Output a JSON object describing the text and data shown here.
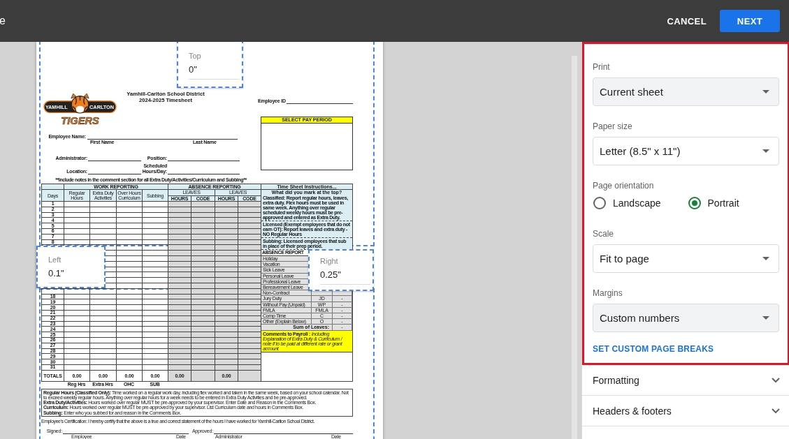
{
  "toolbar": {
    "title": "e",
    "cancel": "CANCEL",
    "next": "NEXT"
  },
  "preview": {
    "document": {
      "logo": {
        "left_word": "YAMHILL",
        "right_word": "CARLTON",
        "wordmark": "TIGERS"
      },
      "title_lines": [
        "Yamhill-Carlton School District",
        "2024-2025 Timesheet"
      ],
      "employee_id_label": "Employee ID",
      "pay_period_heading": "SELECT PAY PERIOD",
      "employee_name_label": "Employee Name:",
      "name_parts": [
        "First Name",
        "Last Name"
      ],
      "detail_fields": [
        "Administrator:",
        "Location:",
        "Position:",
        "Scheduled Hours/Day:"
      ],
      "note": "**Include notes in the comment section for all Extra Duty/Activities/Curriculum and Subbing**",
      "table": {
        "group_headers": [
          "WORK REPORTING",
          "ABSENCE REPORTING"
        ],
        "leaves_headers": [
          "LEAVES",
          "LEAVES"
        ],
        "columns": [
          "Days",
          "Regular Hours",
          "Extra Duty Activities",
          "Over Hours Curriculum",
          "Subbing"
        ],
        "leave_columns": [
          "HOURS",
          "CODE",
          "HOURS",
          "CODE"
        ],
        "rows": [
          {
            "day": "1"
          },
          {
            "day": "2"
          },
          {
            "day": "3"
          },
          {
            "day": "4"
          },
          {
            "day": "5"
          },
          {
            "day": "6"
          },
          {
            "day": "7"
          },
          {
            "day": "8"
          },
          {},
          {},
          {},
          {},
          {},
          {},
          {},
          {},
          {},
          {
            "day": "18"
          },
          {
            "day": "19"
          },
          {
            "day": "20"
          },
          {
            "day": "21"
          },
          {
            "day": "22"
          },
          {
            "day": "23"
          },
          {
            "day": "24"
          },
          {
            "day": "25"
          },
          {
            "day": "26"
          },
          {
            "day": "27"
          },
          {
            "day": "28"
          },
          {
            "day": "29"
          },
          {
            "day": "30"
          },
          {
            "day": "31"
          }
        ],
        "totals_label": "TOTALS",
        "totals": [
          "0.00",
          "0.00",
          "0.00",
          "0.00"
        ],
        "leave_totals": [
          "0.00",
          "0.00"
        ],
        "total_captions": [
          "Reg Hrs",
          "Extra Hrs",
          "OHC",
          "SUB"
        ]
      },
      "instructions": {
        "heading": "Time Sheet Instructions...",
        "question": "What did you mark at the top?",
        "paragraphs": [
          "Classified: Report regular hours, leaves, extra duty. Flex hours must be used in same week. Anything over regular scheduled weekly hours must be pre-approved and entered as Extra Duty.",
          "Licensed (Exempt employees that do not earn OT): Report leaves and extra duty - NO Regular Hours",
          "Subbing:  Licensed employees that sub in place of their prep period."
        ]
      },
      "absence_report": {
        "heading": "ABSENCE REPORT",
        "rows": [
          {
            "name": "Holiday"
          },
          {
            "name": "Vacation"
          },
          {
            "name": "Sick Leave"
          },
          {
            "name": "Personal Leave"
          },
          {
            "name": "Professional Leave"
          },
          {
            "name": "Bereavement Leave"
          },
          {
            "name": "Non-Contract"
          },
          {
            "name": "Jury Duty",
            "code": "JD",
            "value": "-"
          },
          {
            "name": "Without Pay (Unpaid)",
            "code": "WP",
            "value": "-"
          },
          {
            "name": "FMLA",
            "code": "FMLA",
            "value": "-"
          },
          {
            "name": "Comp Time",
            "code": "C",
            "value": "-"
          },
          {
            "name": "Other (Explain Below)",
            "code": "O",
            "value": "-"
          }
        ],
        "sum_label": "Sum of Leaves:",
        "sum_value": "-"
      },
      "comments": "**Comments to Payroll :** *Including Explanation of Extra Duty & Curriculum / note if to be paid at different rate or grant account*",
      "definitions": [
        "**Regular Hours (Classified Only):** Time worked on a regular work day, including flex worked and taken in the same week, based on your school calendar. Not to exceed weekly regular hours. Anything over regular hours for a week needs to be entered in Extra Duty Activities and be pre-approved.",
        "**Extra Duty/Activities:** Hours worked over regular MUST be pre-approved by your supervisor. Enter Date and Reason in the Comments Box.",
        "**Curriculum:** Hours worked over regular MUST be pre-approved by your supervisor. List Curriculum date and hours in Comments Box.",
        "**Subbing:** Enter who you subbed for and reason in the Comments Box."
      ],
      "certification": "Employee's Certification: I hereby certify that the above is a true and correct statement of the hours I have worked for Yamhill-Carlton School District.",
      "signatures": {
        "signed_label": "Signed:",
        "approved_label": "Approved:",
        "captions": [
          "Employee",
          "Date",
          "Administrator",
          "Date"
        ]
      }
    },
    "margin_fields": [
      {
        "kind": "top",
        "label": "Top",
        "value": "0\""
      },
      {
        "kind": "left",
        "label": "Left",
        "value": "0.1\""
      },
      {
        "kind": "right",
        "label": "Right",
        "value": "0.25\""
      }
    ]
  },
  "settings": {
    "outlined": true,
    "fields": [
      {
        "kind": "select",
        "label": "Print",
        "value": "Current sheet",
        "highlighted": true
      },
      {
        "kind": "select",
        "label": "Paper size",
        "value": "Letter (8.5\" x 11\")",
        "highlighted": false
      },
      {
        "kind": "radio",
        "label": "Page orientation",
        "options": [
          {
            "label": "Landscape",
            "selected": false
          },
          {
            "label": "Portrait",
            "selected": true
          }
        ]
      },
      {
        "kind": "select",
        "label": "Scale",
        "value": "Fit to page",
        "highlighted": false
      },
      {
        "kind": "select",
        "label": "Margins",
        "value": "Custom numbers",
        "highlighted": true
      }
    ],
    "link": "SET CUSTOM PAGE BREAKS",
    "sections": [
      {
        "label": "Formatting",
        "expanded": false
      },
      {
        "label": "Headers & footers",
        "expanded": false
      }
    ]
  }
}
